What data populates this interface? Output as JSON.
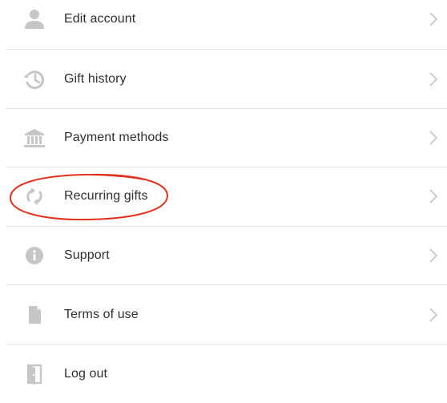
{
  "menu": {
    "items": [
      {
        "label": "Edit account",
        "icon": "person-icon",
        "has_chevron": true
      },
      {
        "label": "Gift history",
        "icon": "history-icon",
        "has_chevron": true
      },
      {
        "label": "Payment methods",
        "icon": "bank-icon",
        "has_chevron": true
      },
      {
        "label": "Recurring gifts",
        "icon": "recurring-icon",
        "has_chevron": true
      },
      {
        "label": "Support",
        "icon": "info-icon",
        "has_chevron": true
      },
      {
        "label": "Terms of use",
        "icon": "document-icon",
        "has_chevron": true
      },
      {
        "label": "Log out",
        "icon": "door-icon",
        "has_chevron": false
      }
    ]
  },
  "colors": {
    "icon": "#c6c6c6",
    "text": "#2f2f2f",
    "divider": "#e4e4e4",
    "chevron": "#c4c4c4",
    "annotation": "#e0321f"
  }
}
